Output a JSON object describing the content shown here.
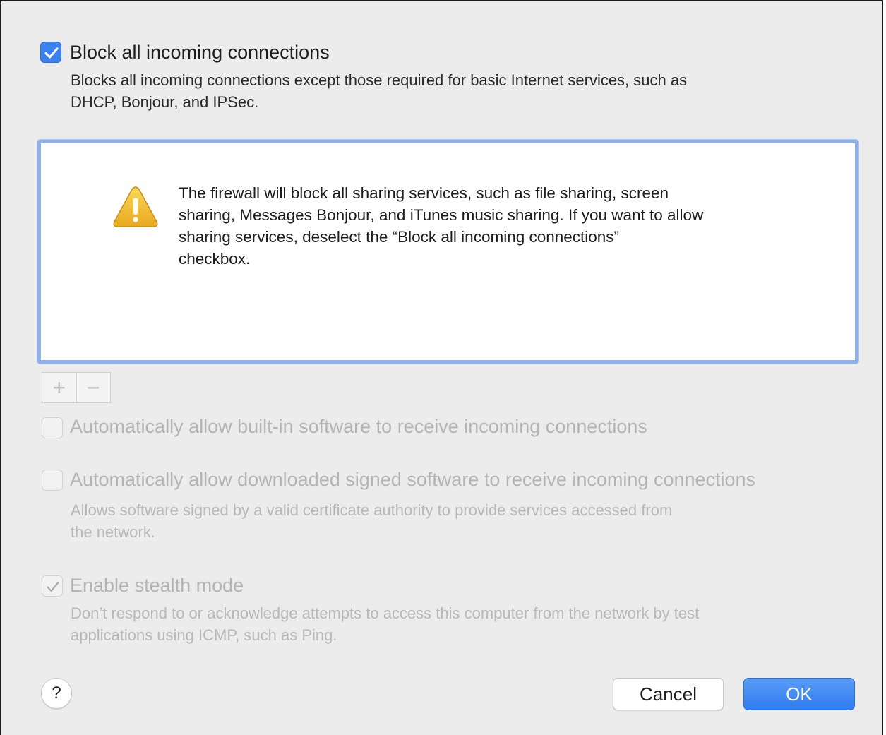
{
  "block_all": {
    "checked": true,
    "label": "Block all incoming connections",
    "description_line1": "Blocks all incoming connections except those required for basic Internet services, such as",
    "description_line2": "DHCP, Bonjour, and IPSec."
  },
  "list": {
    "warning_icon": "warning-triangle-icon",
    "warning_line1": "The firewall will block all sharing services, such as file sharing, screen",
    "warning_line2": "sharing, Messages Bonjour, and iTunes music sharing. If you want to allow",
    "warning_line3": "sharing services, deselect the “Block all incoming connections”",
    "warning_line4": "checkbox."
  },
  "list_controls": {
    "add_label": "+",
    "remove_label": "−"
  },
  "auto_builtin": {
    "checked": false,
    "enabled": false,
    "label": "Automatically allow built-in software to receive incoming connections"
  },
  "auto_signed": {
    "checked": false,
    "enabled": false,
    "label": "Automatically allow downloaded signed software to receive incoming connections",
    "description_line1": "Allows software signed by a valid certificate authority to provide services accessed from",
    "description_line2": "the network."
  },
  "stealth": {
    "checked": true,
    "enabled": false,
    "label": "Enable stealth mode",
    "description_line1": "Don’t respond to or acknowledge attempts to access this computer from the network by test",
    "description_line2": "applications using ICMP, such as Ping."
  },
  "footer": {
    "help_label": "?",
    "cancel_label": "Cancel",
    "ok_label": "OK"
  },
  "colors": {
    "accent": "#3b82f0",
    "focus_ring": "#8fb1e8",
    "warning_yellow": "#f2c230"
  }
}
